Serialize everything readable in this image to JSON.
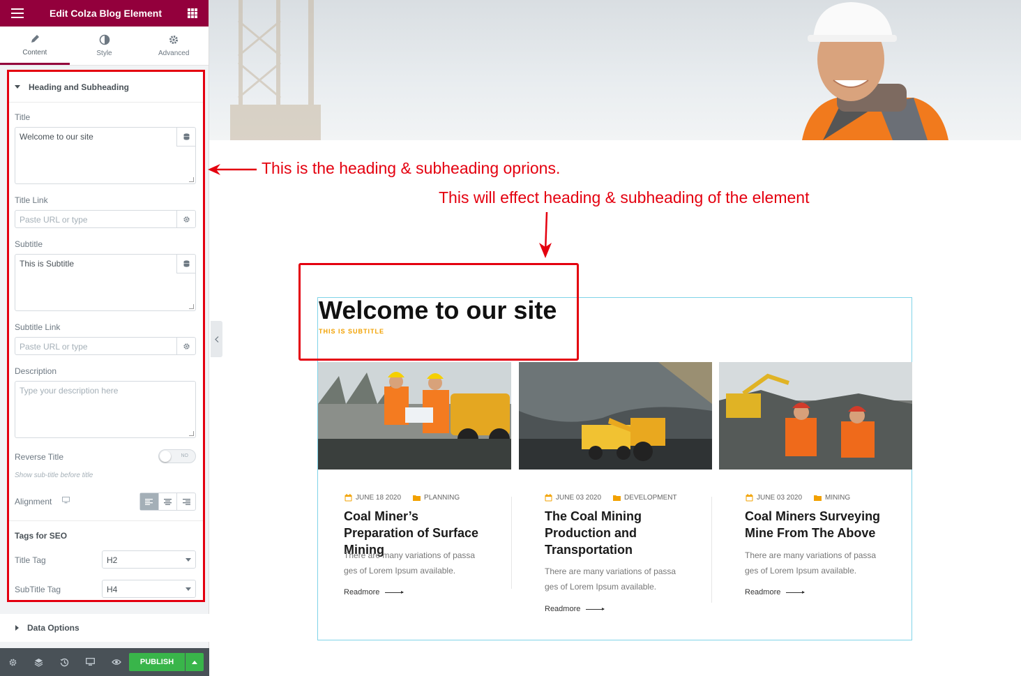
{
  "editor": {
    "title": "Edit Colza Blog Element",
    "tabs": [
      {
        "label": "Content",
        "icon": "pencil-icon"
      },
      {
        "label": "Style",
        "icon": "contrast-icon"
      },
      {
        "label": "Advanced",
        "icon": "gear-icon"
      }
    ],
    "section_heading": "Heading and Subheading",
    "fields": {
      "title_label": "Title",
      "title_value": "Welcome to our site",
      "title_link_label": "Title Link",
      "title_link_placeholder": "Paste URL or type",
      "subtitle_label": "Subtitle",
      "subtitle_value": "This is Subtitle",
      "subtitle_link_label": "Subtitle Link",
      "subtitle_link_placeholder": "Paste URL or type",
      "description_label": "Description",
      "description_placeholder": "Type your description here",
      "reverse_title_label": "Reverse Title",
      "reverse_title_state": "NO",
      "reverse_title_hint": "Show sub-title before title",
      "alignment_label": "Alignment",
      "seo_heading": "Tags for SEO",
      "title_tag_label": "Title Tag",
      "title_tag_value": "H2",
      "subtitle_tag_label": "SubTitle Tag",
      "subtitle_tag_value": "H4"
    },
    "data_options_heading": "Data Options",
    "publish_label": "PUBLISH"
  },
  "annotations": {
    "note1": "This is the heading & subheading oprions.",
    "note2": "This will effect heading & subheading of the element"
  },
  "widget": {
    "title": "Welcome to our site",
    "subtitle": "THIS IS SUBTITLE"
  },
  "cards": [
    {
      "date": "JUNE 18 2020",
      "category": "PLANNING",
      "title": "Coal Miner’s Preparation of Surface Mining",
      "desc": "There are many variations of passa ges of Lorem Ipsum available.",
      "more": "Readmore"
    },
    {
      "date": "JUNE 03 2020",
      "category": "DEVELOPMENT",
      "title": "The Coal Mining Production and Transportation",
      "desc": "There are many variations of passa ges of Lorem Ipsum available.",
      "more": "Readmore"
    },
    {
      "date": "JUNE 03 2020",
      "category": "MINING",
      "title": "Coal Miners Surveying Mine From The Above",
      "desc": "There are many variations of passa ges of Lorem Ipsum available.",
      "more": "Readmore"
    }
  ],
  "colors": {
    "brand": "#93003c",
    "accent": "#f2a100",
    "annotation": "#e4000f",
    "publish": "#39b54a"
  }
}
